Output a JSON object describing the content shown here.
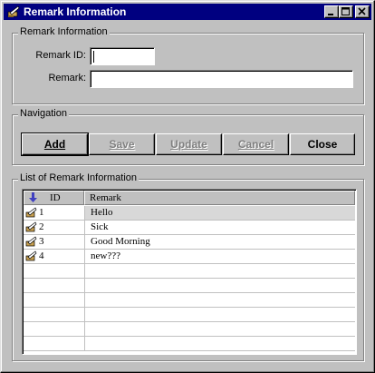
{
  "window": {
    "title": "Remark Information",
    "controls": [
      "minimize-icon",
      "maximize-icon",
      "close-icon"
    ]
  },
  "remark_group": {
    "label": "Remark Information",
    "id_label": "Remark ID:",
    "id_value": "",
    "remark_label": "Remark:",
    "remark_value": ""
  },
  "navigation": {
    "label": "Navigation",
    "buttons": [
      {
        "label": "Add",
        "enabled": true
      },
      {
        "label": "Save",
        "enabled": false
      },
      {
        "label": "Update",
        "enabled": false
      },
      {
        "label": "Cancel",
        "enabled": false
      },
      {
        "label": "Close",
        "enabled": true
      }
    ]
  },
  "list": {
    "label": "List of Remark Information",
    "columns": [
      "ID",
      "Remark"
    ],
    "rows": [
      {
        "id": "1",
        "remark": "Hello"
      },
      {
        "id": "2",
        "remark": "Sick"
      },
      {
        "id": "3",
        "remark": "Good Morning"
      },
      {
        "id": "4",
        "remark": "new???"
      }
    ],
    "selected_row": 0
  }
}
